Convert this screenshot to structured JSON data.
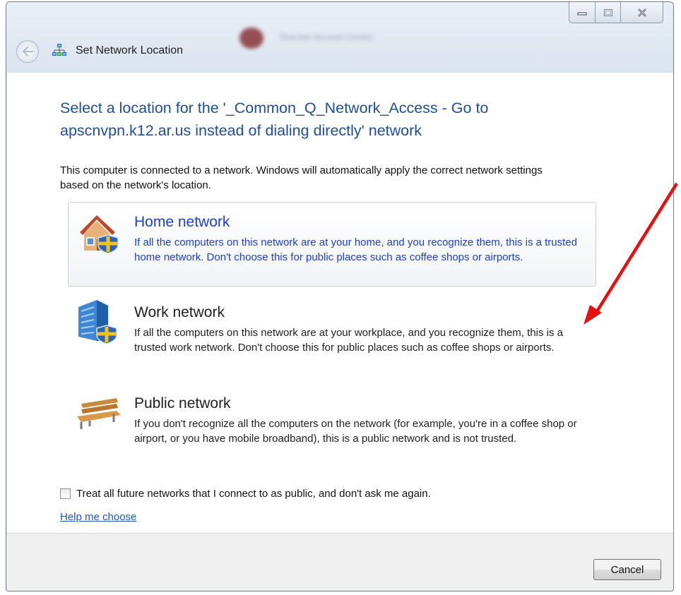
{
  "window": {
    "title": "Set Network Location",
    "background_app_title": "Teacher Access Center"
  },
  "caption_buttons": {
    "minimize_icon": "minimize-icon",
    "maximize_icon": "maximize-icon",
    "close_icon": "close-icon"
  },
  "dialog": {
    "heading": "Select a location for the '_Common_Q_Network_Access - Go to apscnvpn.k12.ar.us instead of dialing directly' network",
    "description": "This computer is connected to a network. Windows will automatically apply the correct network settings based on the network's location.",
    "options": [
      {
        "title": "Home network",
        "description": "If all the computers on this network are at your home, and you recognize them, this is a trusted home network.  Don't choose this for public places such as coffee shops or airports.",
        "icon": "home-network-icon",
        "selected": true
      },
      {
        "title": "Work network",
        "description": "If all the computers on this network are at your workplace, and you recognize them, this is a trusted work network.  Don't choose this for public places such as coffee shops or airports.",
        "icon": "work-network-icon",
        "selected": false
      },
      {
        "title": "Public network",
        "description": "If you don't recognize all the computers on the network (for example, you're in a coffee shop or airport, or you have mobile broadband), this is a public network and is not trusted.",
        "icon": "public-network-icon",
        "selected": false
      }
    ],
    "checkbox_label": "Treat all future networks that I connect to as public, and don't ask me again.",
    "checkbox_checked": false,
    "help_link": "Help me choose",
    "cancel_label": "Cancel"
  },
  "colors": {
    "heading": "#1e4e9a",
    "selected_option_text": "#1d3fd0",
    "link": "#1e56c4",
    "annotation_arrow": "#e8100f"
  }
}
